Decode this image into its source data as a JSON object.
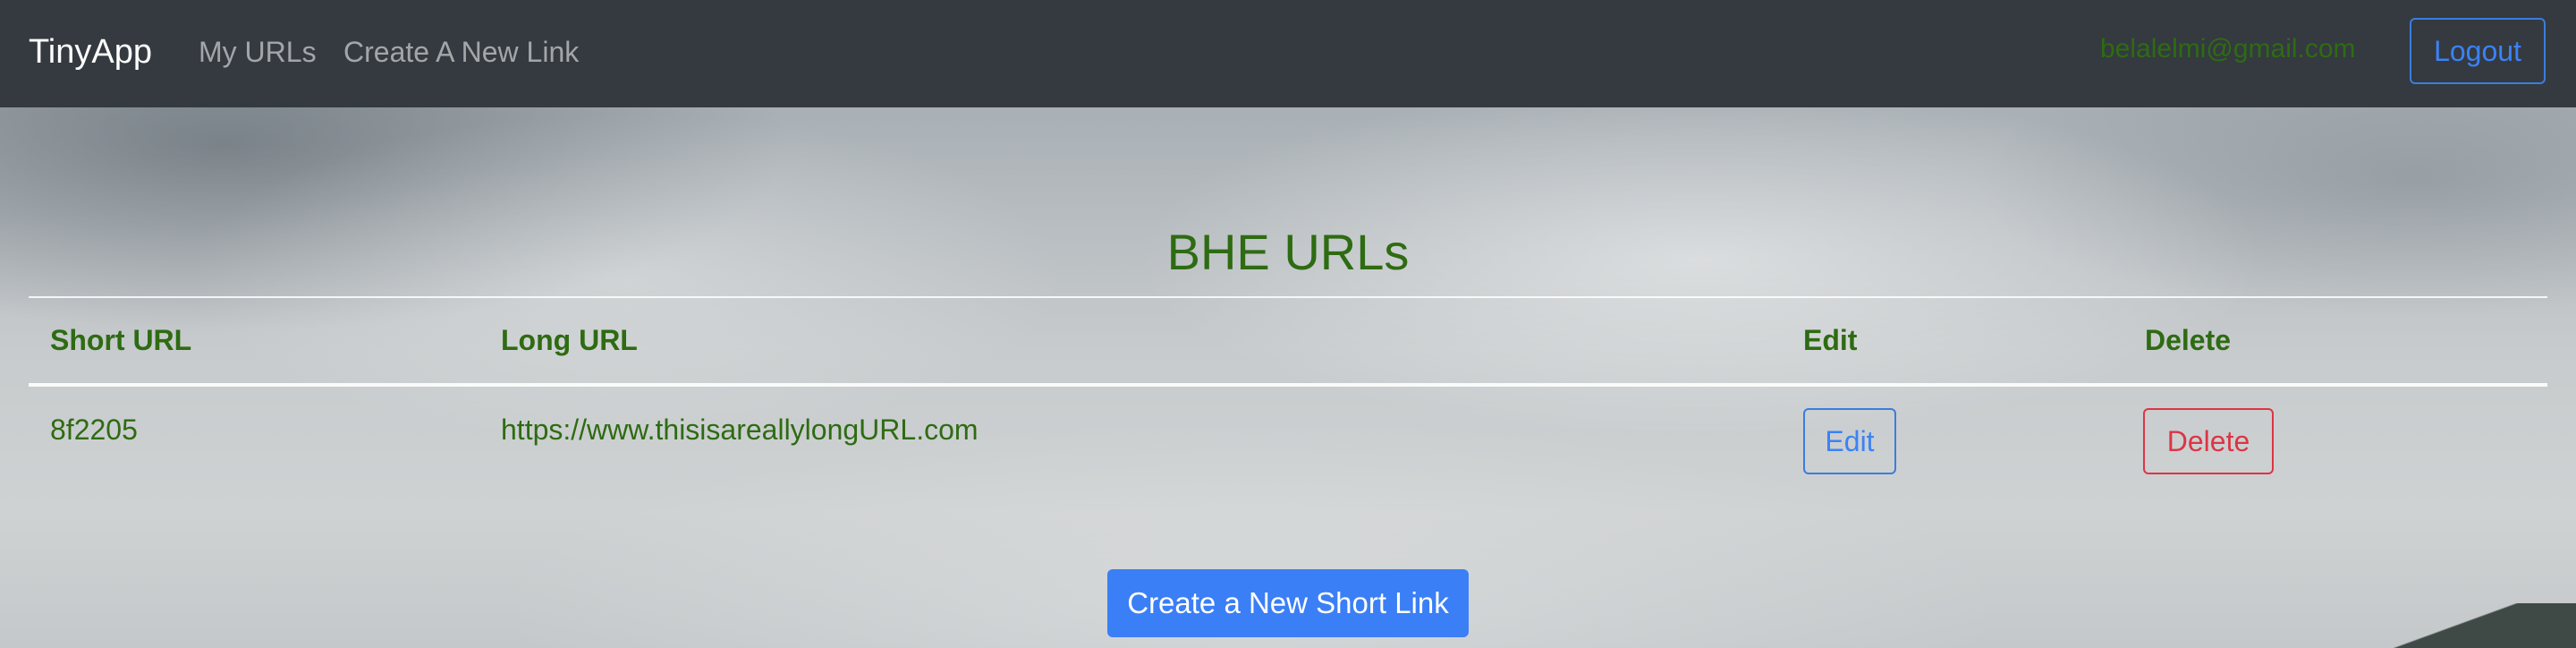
{
  "navbar": {
    "brand": "TinyApp",
    "links": [
      "My URLs",
      "Create A New Link"
    ],
    "user_email": "belalelmi@gmail.com",
    "logout_label": "Logout"
  },
  "main": {
    "title": "BHE URLs",
    "table": {
      "headers": [
        "Short URL",
        "Long URL",
        "Edit",
        "Delete"
      ],
      "rows": [
        {
          "short_url": "8f2205",
          "long_url": "https://www.thisisareallylongURL.com",
          "edit_label": "Edit",
          "delete_label": "Delete"
        }
      ]
    },
    "create_button_label": "Create a New Short Link"
  },
  "colors": {
    "navbar_bg": "#343a40",
    "text_green": "#2e6b12",
    "primary_blue": "#3b7ff6",
    "danger_red": "#dc3545"
  }
}
